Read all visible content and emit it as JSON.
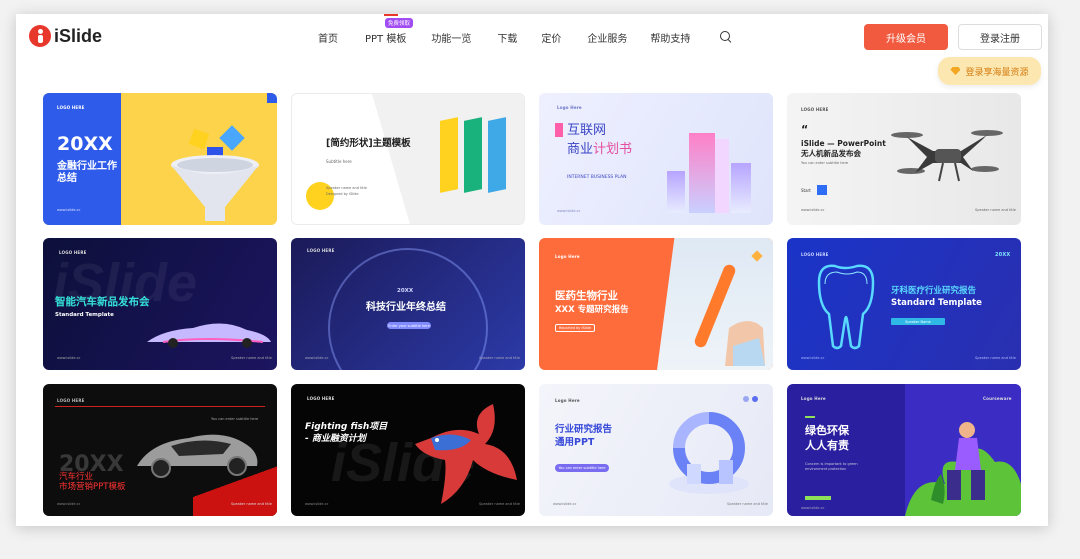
{
  "header": {
    "logo": "iSlide",
    "nav": [
      "首页",
      "PPT 模板",
      "功能一览",
      "下载",
      "定价",
      "企业服务",
      "帮助支持"
    ],
    "nav_badge": "免费领取",
    "vip_button": "升级会员",
    "login_button": "登录注册",
    "tip": "登录享海量资源"
  },
  "colors": {
    "brand_red": "#e8382b",
    "vip_orange": "#f15a3f",
    "badge_purple": "#a24df3",
    "tip_bg": "#fce7b0"
  },
  "cards": [
    {
      "logo": "LOGO HERE",
      "big": "20XX",
      "title": "金融行业工作总结",
      "foot": "www.islide.cc"
    },
    {
      "title": "[简约形状]主题模板",
      "sub": "Subtitle here",
      "meta1": "Speaker name and title",
      "meta2": "Designed by iSlide"
    },
    {
      "logo": "Logo Here",
      "title_a": "互联网",
      "title_b": "商业",
      "title_c": "计划书",
      "sub": "INTERNET BUSINESS PLAN",
      "foot": "www.islide.cc"
    },
    {
      "logo": "LOGO HERE",
      "quote": "“",
      "title_a": "iSlide — PowerPoint",
      "title_b": "无人机新品发布会",
      "sub": "You can enter subtitle here",
      "start": "Start",
      "foot": "www.islide.cc",
      "foot2": "Speaker name and title"
    },
    {
      "logo": "LOGO HERE",
      "title": "智能汽车新品发布会",
      "sub": "Standard Template",
      "foot": "www.islide.cc",
      "foot2": "Speaker name and title"
    },
    {
      "logo": "LOGO HERE",
      "big": "20XX",
      "title": "科技行业年终总结",
      "pill": "Enter your subtitle here",
      "foot": "www.islide.cc",
      "foot2": "Speaker name and title"
    },
    {
      "logo": "Logo Here",
      "title_a": "医药生物行业",
      "title_b": "XXX 专题研究报告",
      "pill": "Reported by iSlide"
    },
    {
      "logo": "LOGO HERE",
      "tag": "20XX",
      "title_a": "牙科医疗行业研究报告",
      "title_b": "Standard Template",
      "pill": "Speaker Name",
      "foot": "www.islide.cc",
      "foot2": "Speaker name and title"
    },
    {
      "logo": "LOGO HERE",
      "sub": "You can enter subtitle here",
      "big": "20XX",
      "title_a": "汽车行业",
      "title_b": "市场营销PPT模板",
      "foot": "www.islide.cc",
      "foot2": "Speaker name and title"
    },
    {
      "logo": "LOGO HERE",
      "title_a": "Fighting fish项目",
      "title_b": "- 商业融资计划",
      "foot": "www.islide.cc",
      "foot2": "Speaker name and title"
    },
    {
      "logo": "Logo Here",
      "title_a": "行业研究报告",
      "title_b": "通用PPT",
      "pill": "You can enter subtitle here",
      "foot": "www.islide.cc",
      "foot2": "Speaker name and title"
    },
    {
      "logo": "Logo Here",
      "corner": "Courseware",
      "title_a": "绿色环保",
      "title_b": "人人有责",
      "sub": "Concern is important to green environment protection",
      "foot": "www.islide.cc"
    }
  ]
}
